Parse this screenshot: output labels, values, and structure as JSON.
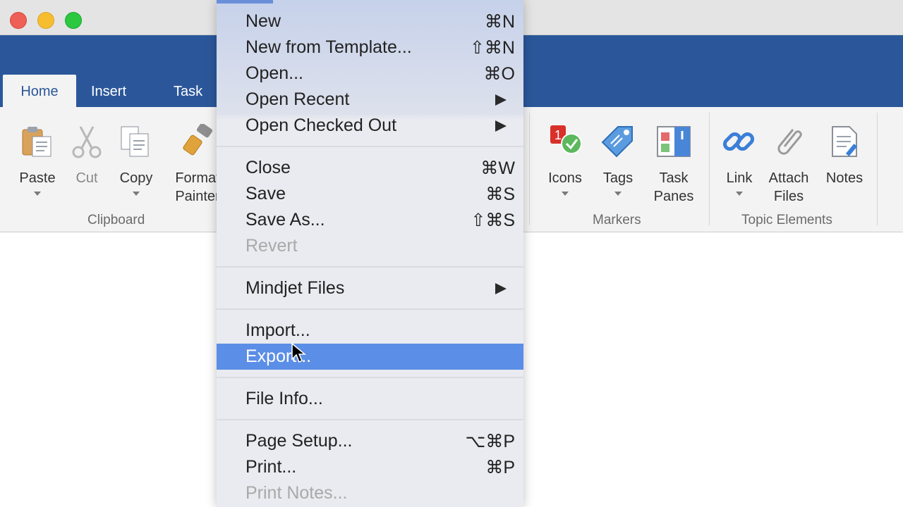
{
  "ribbon": {
    "tabs": [
      {
        "label": "Home"
      },
      {
        "label": "Insert"
      },
      {
        "label": "Task"
      }
    ],
    "clipboard": {
      "paste_label": "Paste",
      "cut_label": "Cut",
      "copy_label": "Copy",
      "format_painter_label_1": "Format",
      "format_painter_label_2": "Painter",
      "group_label": "Clipboard"
    },
    "markers": {
      "icons_label": "Icons",
      "tags_label": "Tags",
      "task_panes_label_1": "Task",
      "task_panes_label_2": "Panes",
      "group_label": "Markers"
    },
    "topic_elements": {
      "link_label": "Link",
      "attach_files_label_1": "Attach",
      "attach_files_label_2": "Files",
      "notes_label": "Notes",
      "group_label": "Topic Elements"
    }
  },
  "menu": {
    "items": [
      {
        "label": "New",
        "shortcut": "⌘N"
      },
      {
        "label": "New from Template...",
        "shortcut": "⇧⌘N"
      },
      {
        "label": "Open...",
        "shortcut": "⌘O"
      },
      {
        "label": "Open Recent",
        "shortcut": ""
      },
      {
        "label": "Open Checked Out",
        "shortcut": ""
      },
      {
        "label": "Close",
        "shortcut": "⌘W"
      },
      {
        "label": "Save",
        "shortcut": "⌘S"
      },
      {
        "label": "Save As...",
        "shortcut": "⇧⌘S"
      },
      {
        "label": "Revert",
        "shortcut": ""
      },
      {
        "label": "Mindjet Files",
        "shortcut": ""
      },
      {
        "label": "Import...",
        "shortcut": ""
      },
      {
        "label": "Export...",
        "shortcut": ""
      },
      {
        "label": "File Info...",
        "shortcut": ""
      },
      {
        "label": "Page Setup...",
        "shortcut": "⌥⌘P"
      },
      {
        "label": "Print...",
        "shortcut": "⌘P"
      },
      {
        "label": "Print Notes...",
        "shortcut": ""
      }
    ]
  },
  "colors": {
    "ribbon_blue": "#2b579a",
    "menu_highlight": "#5b8ee6"
  }
}
